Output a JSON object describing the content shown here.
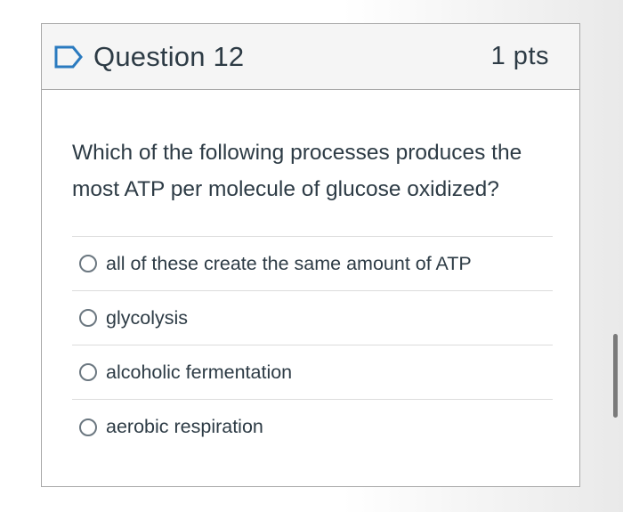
{
  "question": {
    "name": "Question 12",
    "points": "1 pts",
    "text": "Which of the following processes produces the most ATP per molecule of glucose oxidized?",
    "answers": [
      {
        "label": "all of these create the same amount of ATP",
        "selected": false
      },
      {
        "label": "glycolysis",
        "selected": false
      },
      {
        "label": "alcoholic fermentation",
        "selected": false
      },
      {
        "label": "aerobic respiration",
        "selected": false
      }
    ]
  },
  "icons": {
    "flag": "flag-outline-icon",
    "radio": "radio-unchecked-icon"
  },
  "colors": {
    "accent": "#2a7abf",
    "text": "#2d3b45",
    "header_bg": "#f5f5f5",
    "border": "#a8a8a8"
  }
}
